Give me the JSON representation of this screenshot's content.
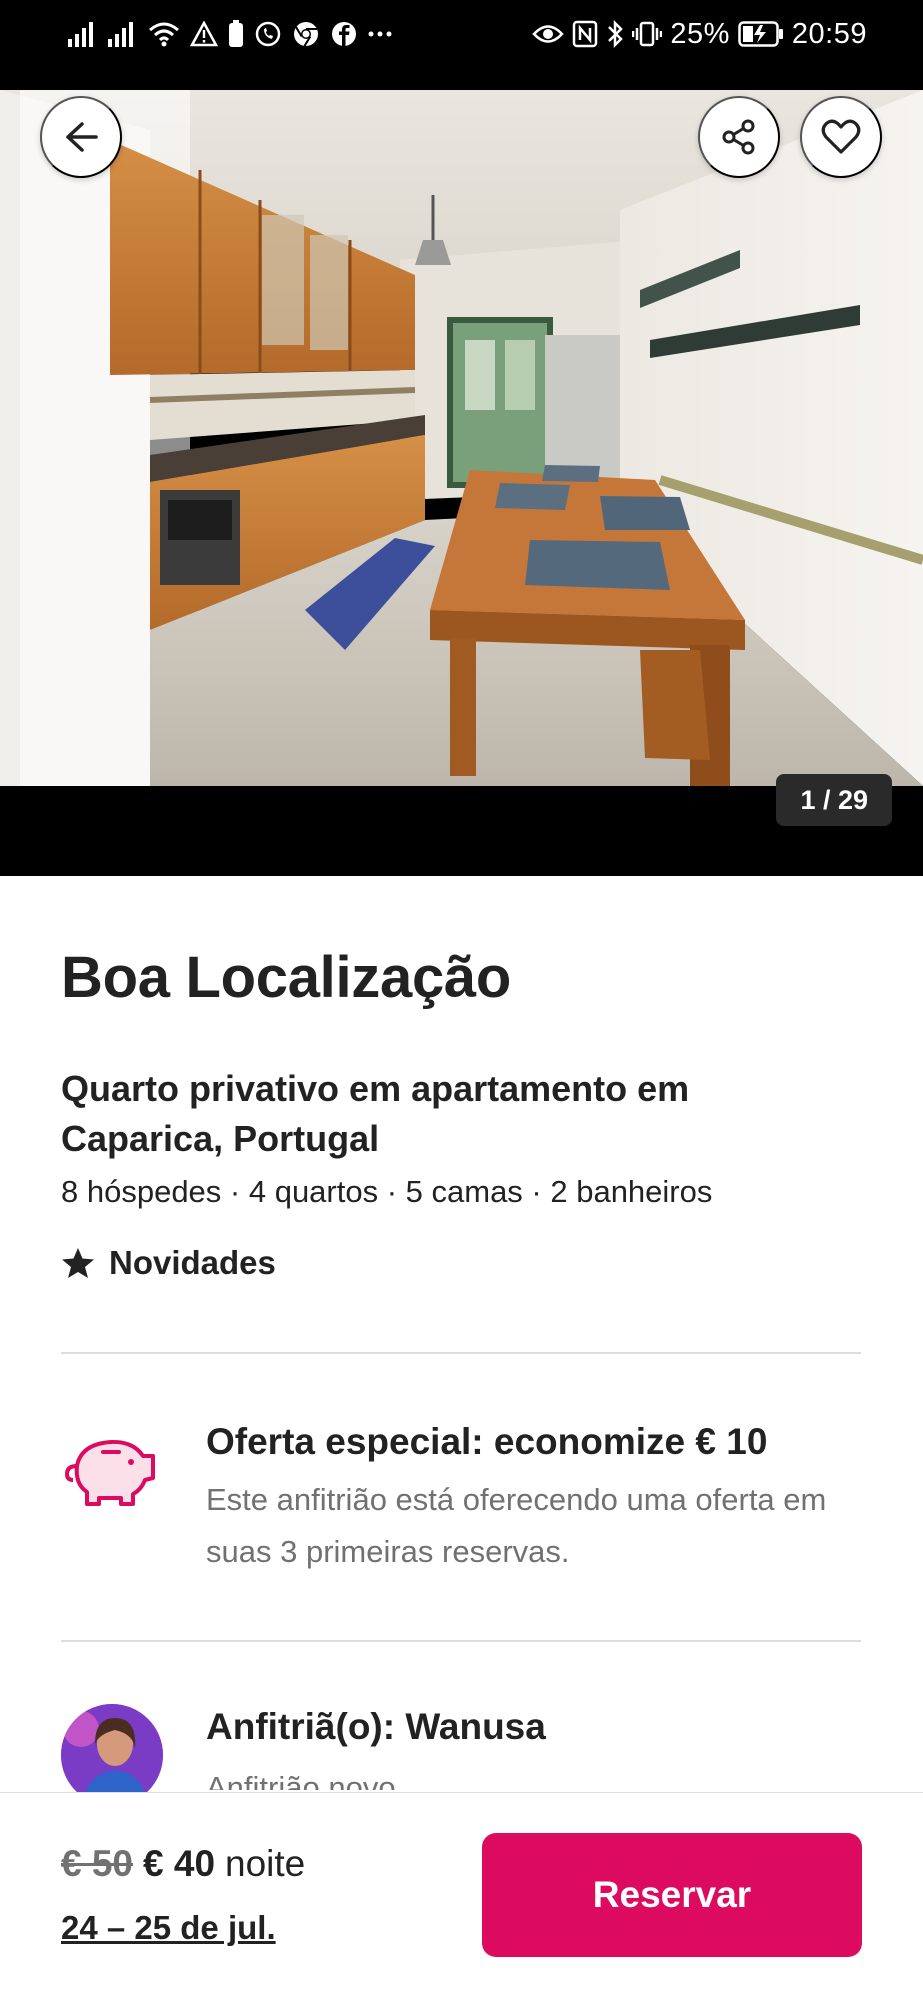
{
  "status_bar": {
    "left_icons": [
      "signal-icon",
      "signal-icon",
      "wifi-icon",
      "warning-icon",
      "battery-small-icon",
      "whatsapp-icon",
      "chrome-icon",
      "facebook-icon",
      "more-dots-icon"
    ],
    "right_icons": [
      "eye-icon",
      "nfc-icon",
      "bluetooth-icon",
      "vibrate-icon"
    ],
    "battery_percent": "25%",
    "time": "20:59"
  },
  "photo": {
    "counter": "1 / 29",
    "back_icon": "arrow-left-icon",
    "share_icon": "share-icon",
    "favorite_icon": "heart-icon"
  },
  "listing": {
    "title": "Boa Localização",
    "subtitle": "Quarto privativo em apartamento em Caparica, Portugal",
    "details": "8 hóspedes · 4 quartos · 5 camas · 2 banheiros",
    "rating_label": "Novidades",
    "rating_icon": "star-icon"
  },
  "offer": {
    "icon": "piggy-bank-icon",
    "title": "Oferta especial: economize € 10",
    "description": "Este anfitrião está oferecendo uma oferta em suas 3 primeiras reservas."
  },
  "host": {
    "title": "Anfitriã(o): Wanusa",
    "subtitle": "Anfitrião novo"
  },
  "footer": {
    "old_price": "€ 50",
    "new_price": "€ 40",
    "unit": "noite",
    "dates": "24 – 25 de jul.",
    "reserve_label": "Reservar"
  },
  "colors": {
    "accent": "#dc0b5f",
    "text": "#222222",
    "muted": "#717171",
    "divider": "#dddddd"
  }
}
